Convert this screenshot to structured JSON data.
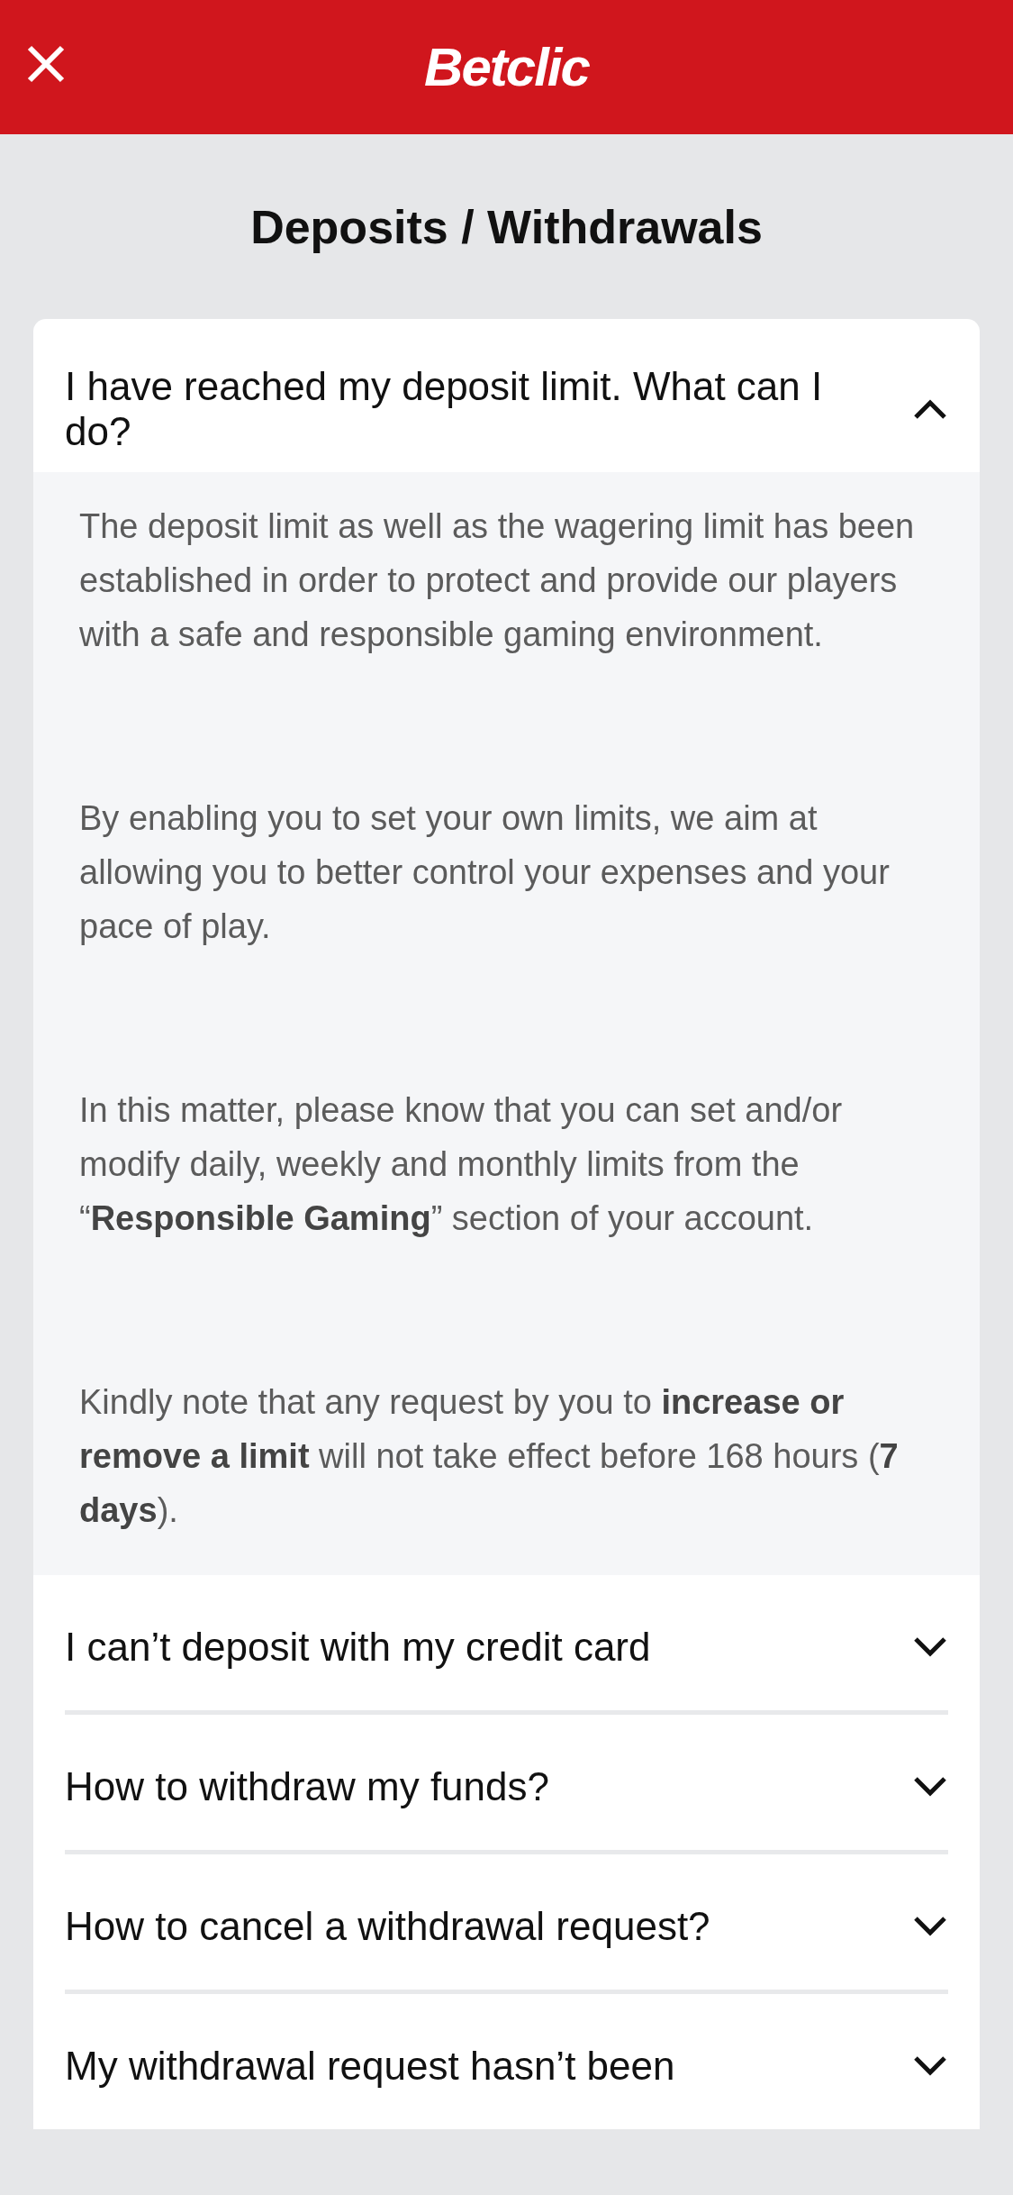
{
  "header": {
    "logo": "Betclic"
  },
  "title": "Deposits / Withdrawals",
  "faqs": [
    {
      "question": "I have reached my deposit limit. What can I do?",
      "expanded": true,
      "answer": [
        "The deposit limit as well as the wagering limit has been established in order to protect and provide our players with a safe and responsible gaming environment.",
        "By enabling you to set your own limits, we aim at allowing you to better control your expenses and your pace of play.",
        "In this matter, please know that you can set and/or modify daily, weekly and monthly limits from the “**Responsible Gaming**” section of your account.",
        "Kindly note that any request by you to **increase or remove a limit** will not take effect before 168 hours (**7 days**)."
      ]
    },
    {
      "question": "I can’t deposit with my credit card",
      "expanded": false
    },
    {
      "question": "How to withdraw my funds?",
      "expanded": false
    },
    {
      "question": "How to cancel a withdrawal request?",
      "expanded": false
    },
    {
      "question": "My withdrawal request hasn’t been",
      "expanded": false
    }
  ]
}
